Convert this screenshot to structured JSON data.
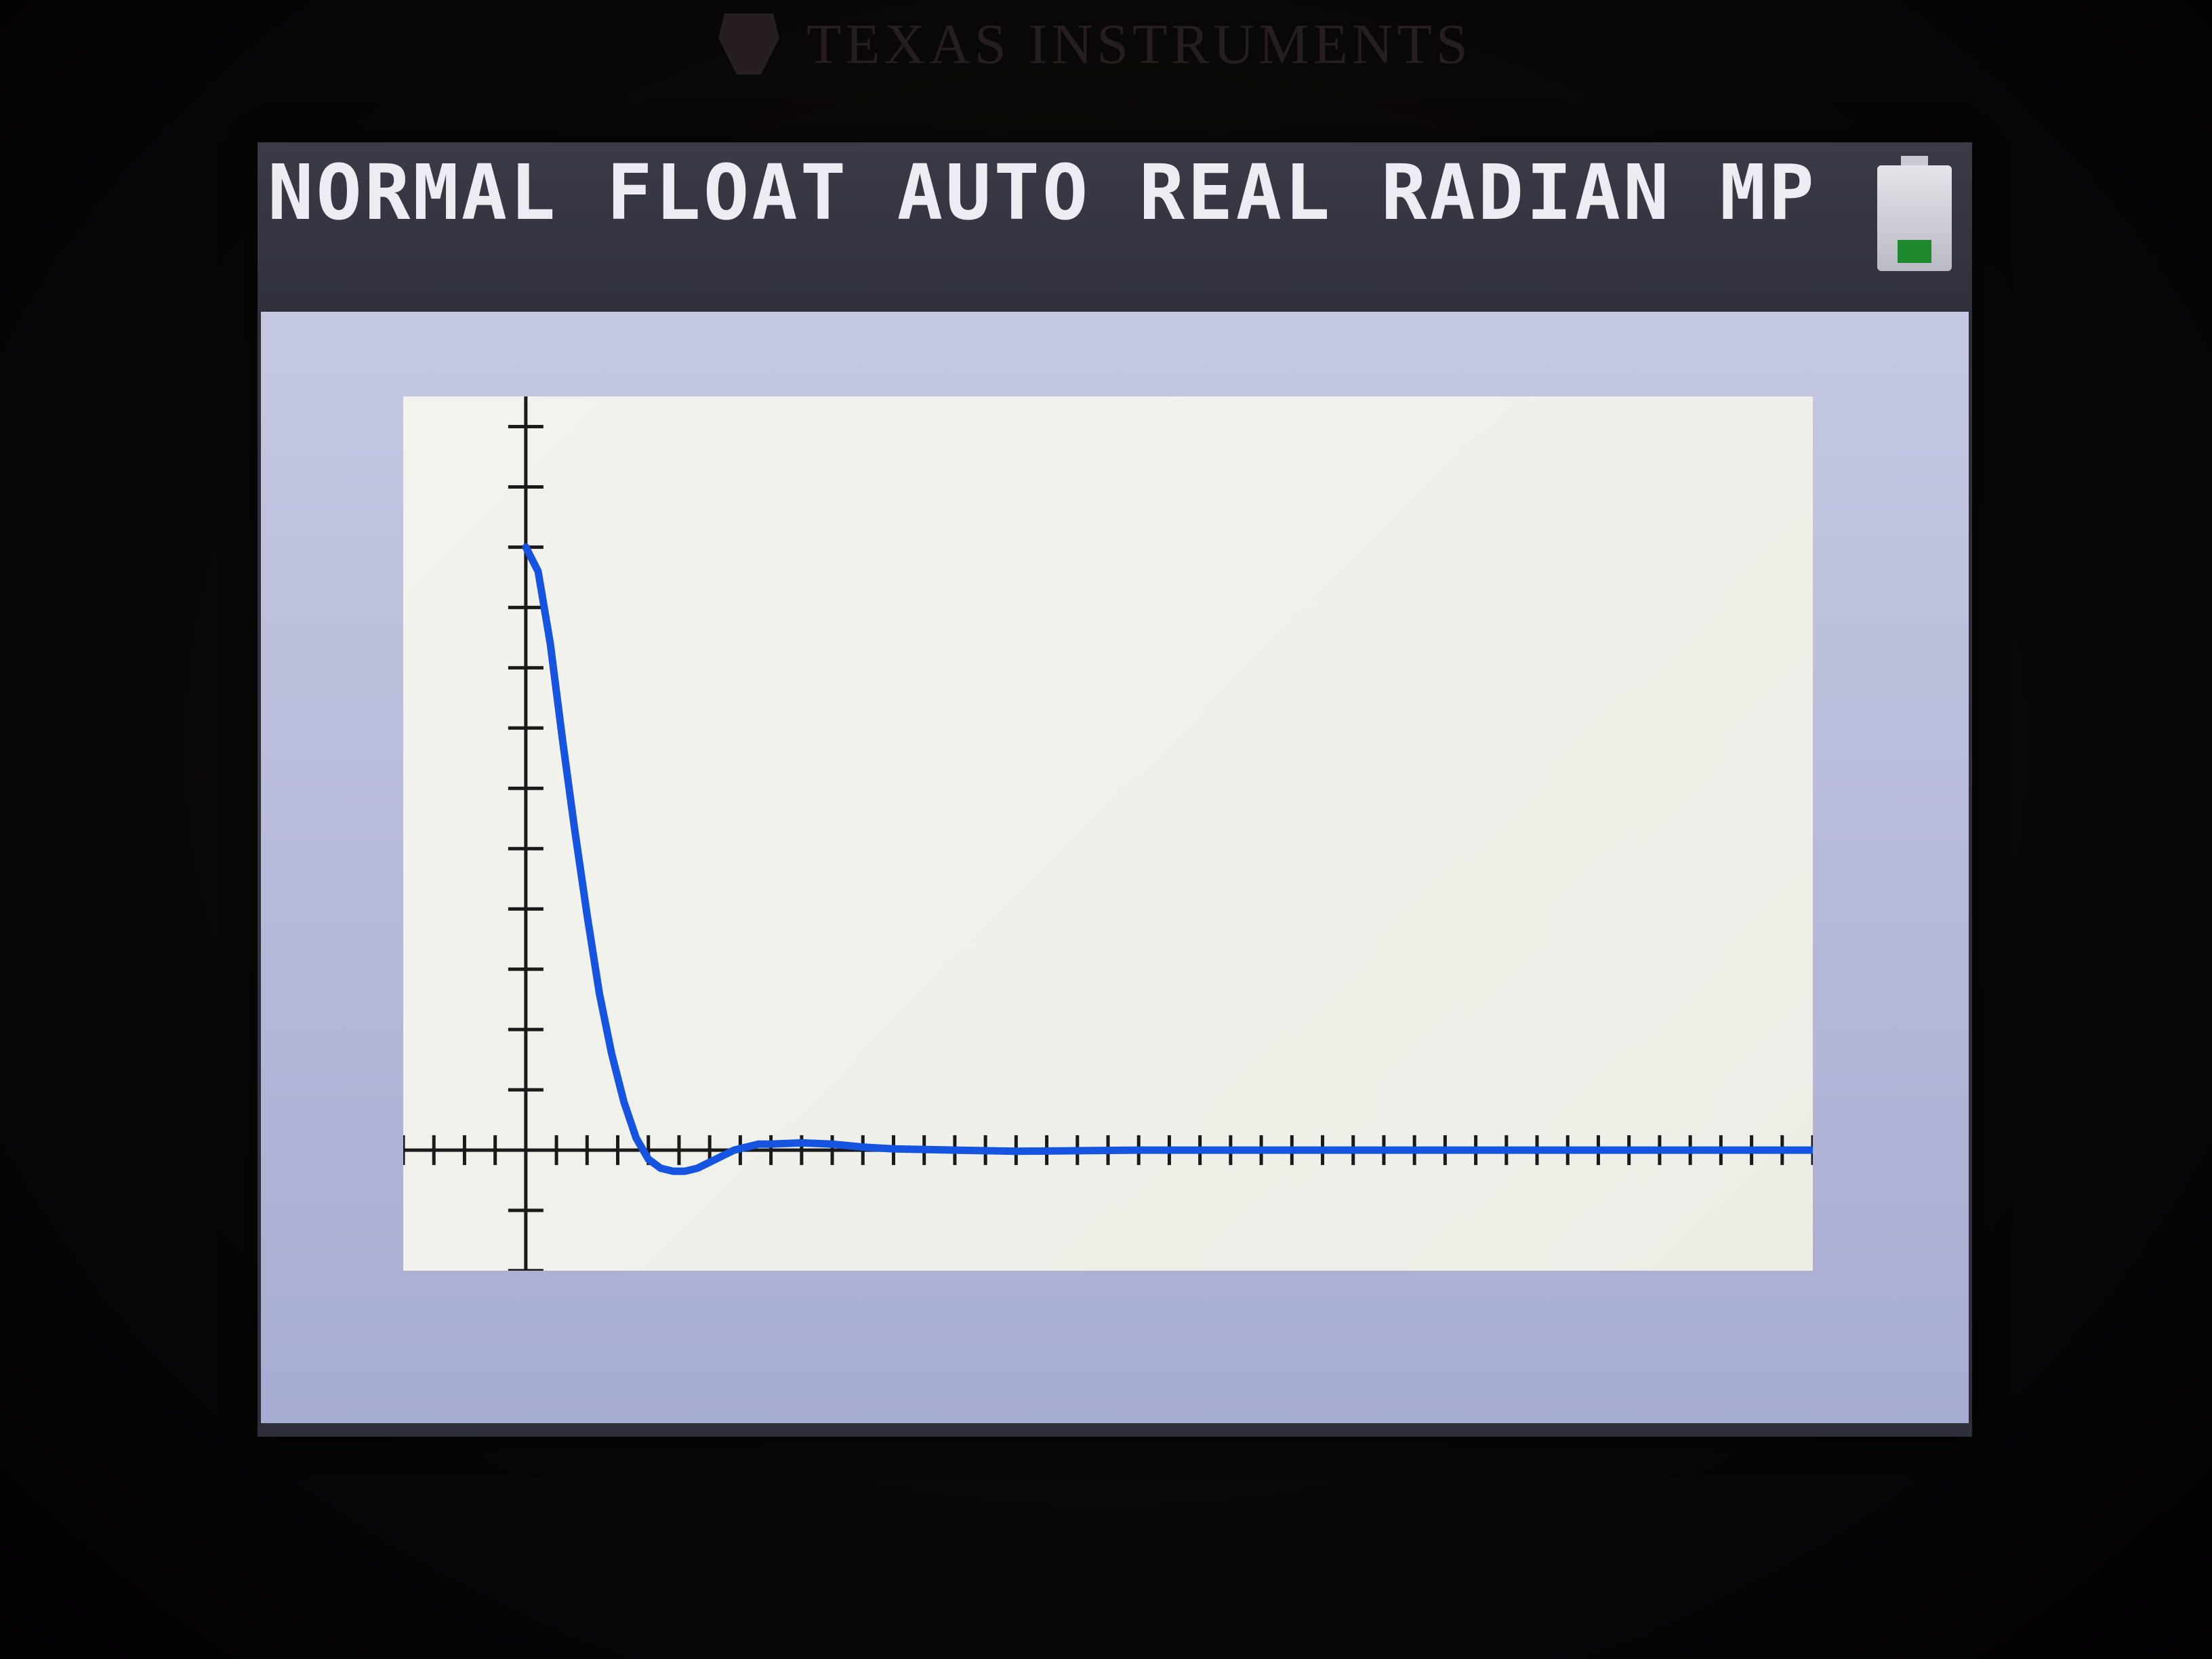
{
  "device": {
    "brand": "TEXAS INSTRUMENTS",
    "status_bar": {
      "modes": [
        "NORMAL",
        "FLOAT",
        "AUTO",
        "REAL",
        "RADIAN",
        "MP"
      ],
      "text": "NORMAL FLOAT AUTO REAL RADIAN MP",
      "battery_icon": "battery-icon",
      "battery_level": 0.25
    }
  },
  "colors": {
    "status_bar_bg": "#33343f",
    "graph_bg": "#b8bcdc",
    "plot_bg": "#f0f1ea",
    "curve": "#1554e0",
    "axes": "#1a1a1a",
    "battery_fill": "#1f8a2d"
  },
  "chart_data": {
    "type": "line",
    "title": "",
    "xlabel": "",
    "ylabel": "",
    "xlim": [
      -2,
      21
    ],
    "ylim": [
      -2,
      12.5
    ],
    "xscl": 0.5,
    "yscl": 1,
    "grid": false,
    "series": [
      {
        "x": [
          0,
          0.2,
          0.4,
          0.6,
          0.8,
          1.0,
          1.2,
          1.4,
          1.6,
          1.8,
          2.0,
          2.2,
          2.4,
          2.6,
          2.8,
          3.0,
          3.2,
          3.4,
          3.6,
          3.8,
          4.0,
          4.5,
          5.0,
          5.5,
          6.0,
          7.0,
          8.0,
          10.0,
          12.0,
          15.0,
          18.0,
          21.0
        ],
        "y": [
          10,
          9.6,
          8.4,
          6.8,
          5.3,
          3.9,
          2.6,
          1.6,
          0.8,
          0.2,
          -0.15,
          -0.3,
          -0.35,
          -0.35,
          -0.3,
          -0.2,
          -0.1,
          0.0,
          0.05,
          0.1,
          0.1,
          0.12,
          0.1,
          0.05,
          0.02,
          0.0,
          -0.02,
          0.0,
          0.0,
          0.0,
          0.0,
          0.0
        ]
      }
    ]
  }
}
